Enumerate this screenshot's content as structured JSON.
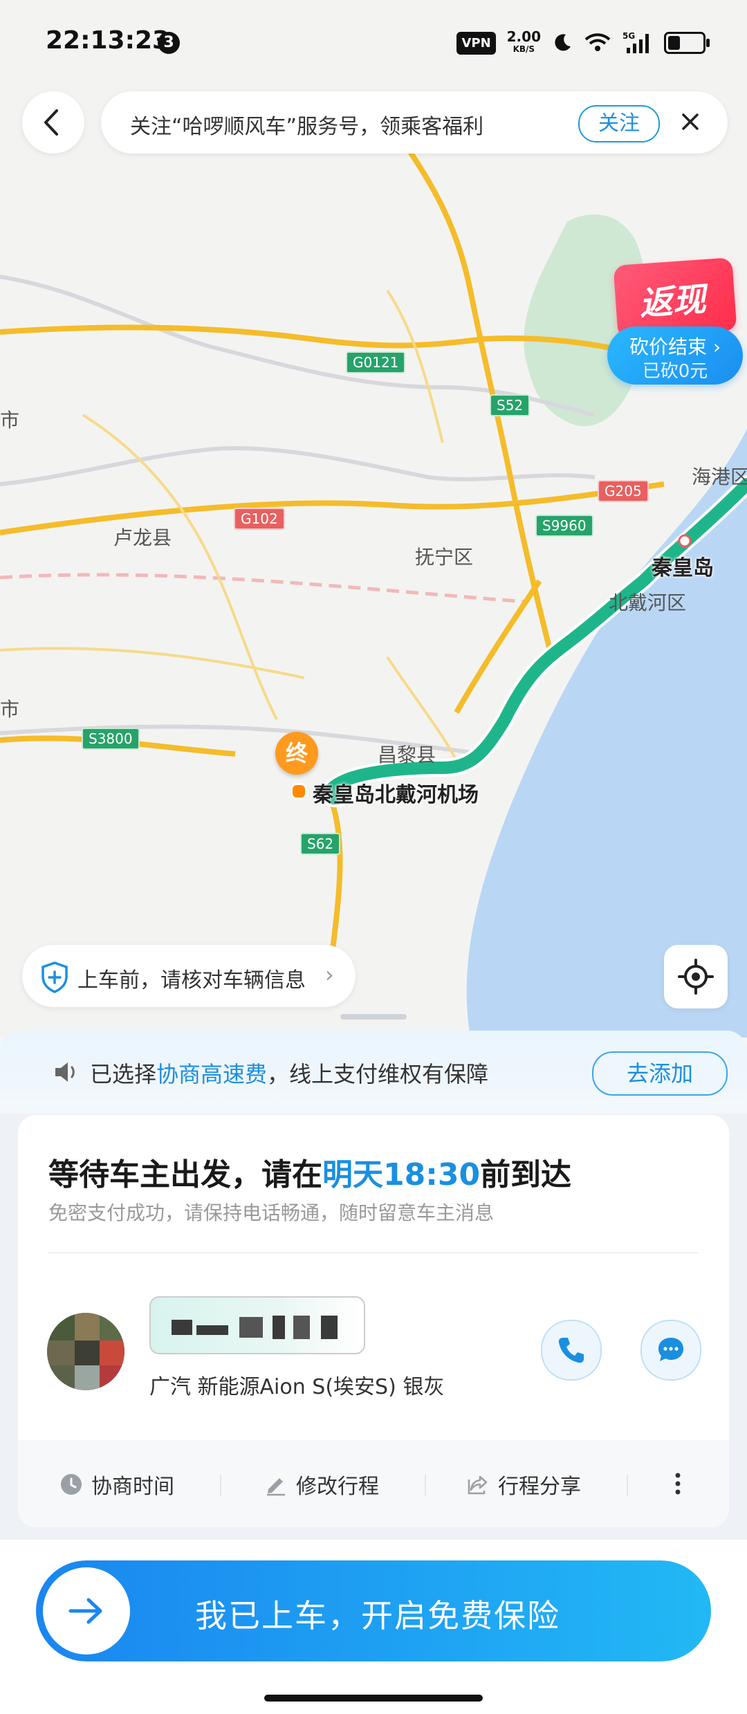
{
  "status_bar": {
    "time": "22:13:23",
    "notification_count": "3",
    "vpn": "VPN",
    "net_speed": "2.00",
    "net_unit": "KB/S",
    "network": "5G",
    "battery_level": 0.35
  },
  "banner": {
    "text": "关注“哈啰顺风车”服务号，领乘客福利",
    "follow_label": "关注"
  },
  "cashback": {
    "badge": "返现",
    "line1": "砍价结束",
    "line2": "已砍0元"
  },
  "map": {
    "places": [
      "卢龙县",
      "抚宁区",
      "昌黎县",
      "北戴河区",
      "市",
      "市"
    ],
    "right_top_label": "海港区",
    "qinhuangdao": "秦皇岛",
    "destination_label": "秦皇岛北戴河机场",
    "end_pin": "终",
    "roads": [
      "G0121",
      "S52",
      "G205",
      "G102",
      "S9960",
      "S3800",
      "S62"
    ]
  },
  "verify_chip": {
    "text": "上车前，请核对车辆信息"
  },
  "toll": {
    "prefix": "已选择",
    "highlight": "协商高速费",
    "suffix": "，线上支付维权有保障",
    "add_label": "去添加"
  },
  "trip": {
    "title_prefix": "等待车主出发，请在",
    "title_time": "明天18:30",
    "title_suffix": "前到达",
    "subtitle": "免密支付成功，请保持电话畅通，随时留意车主消息",
    "car_model": "广汽 新能源Aion S(埃安S) 银灰"
  },
  "actions": [
    {
      "label": "协商时间",
      "icon": "clock-icon"
    },
    {
      "label": "修改行程",
      "icon": "pencil-icon"
    },
    {
      "label": "行程分享",
      "icon": "share-icon"
    }
  ],
  "cta": {
    "label": "我已上车，开启免费保险"
  },
  "colors": {
    "accent": "#1a8fe0",
    "route": "#1fb58a",
    "end_pin": "#ff9a1f",
    "highway": "#f5bc2a"
  }
}
